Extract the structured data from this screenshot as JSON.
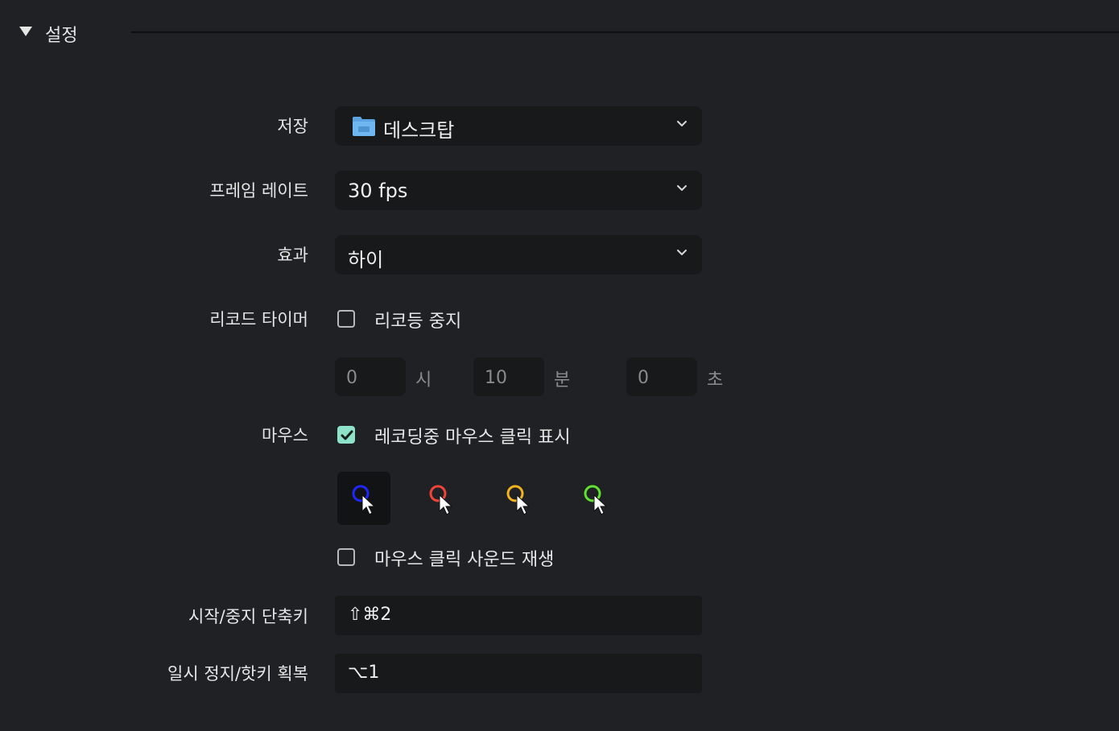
{
  "section": {
    "title": "설정"
  },
  "save": {
    "label": "저장",
    "value": "데스크탑",
    "icon": "folder-icon"
  },
  "frame_rate": {
    "label": "프레임 레이트",
    "value": "30 fps"
  },
  "effect": {
    "label": "효과",
    "value": "하이"
  },
  "record_timer": {
    "label": "리코드 타이머",
    "checkbox_label": "리코등 중지",
    "checked": false,
    "hours": {
      "value": "0",
      "unit": "시"
    },
    "minutes": {
      "value": "10",
      "unit": "분"
    },
    "seconds": {
      "value": "0",
      "unit": "초"
    }
  },
  "mouse": {
    "label": "마우스",
    "show_clicks_label": "레코딩중 마우스 클릭 표시",
    "show_clicks_checked": true,
    "cursor_colors": [
      "#1f27ff",
      "#f0443a",
      "#f2b321",
      "#61e12f"
    ],
    "selected_color_index": 0,
    "sound_label": "마우스 클릭 사운드 재생",
    "sound_checked": false
  },
  "start_stop_shortcut": {
    "label": "시작/중지 단축키",
    "value": "⇧⌘2"
  },
  "pause_shortcut": {
    "label": "일시 정지/핫키 획복",
    "value": "⌥1"
  },
  "colors": {
    "background": "#202124",
    "field": "#18191b",
    "accent_check": "#8de2c7"
  }
}
